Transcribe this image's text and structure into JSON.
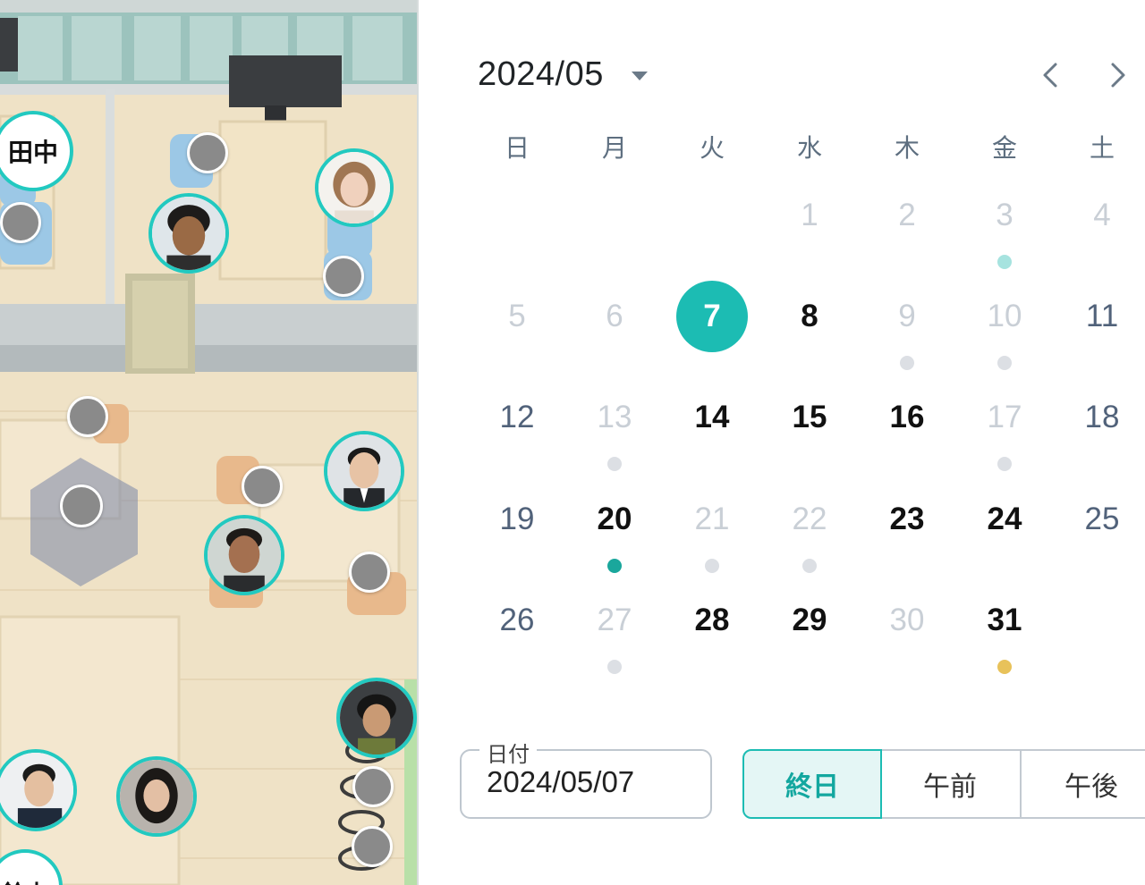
{
  "map": {
    "avatars": [
      {
        "name": "avatar-tanaka-label",
        "label": "田中"
      },
      {
        "name": "avatar-man-curly-hair",
        "label": ""
      },
      {
        "name": "avatar-woman-bob-hair",
        "label": ""
      },
      {
        "name": "avatar-man-suit-glasses",
        "label": ""
      },
      {
        "name": "avatar-man-dark-shirt",
        "label": ""
      },
      {
        "name": "avatar-man-headphones",
        "label": ""
      },
      {
        "name": "avatar-man-suit-smiling",
        "label": ""
      },
      {
        "name": "avatar-woman-long-hair",
        "label": ""
      }
    ],
    "bottom_badge_label": "鈴木"
  },
  "calendar": {
    "month_label": "2024/05",
    "weekdays": [
      "日",
      "月",
      "火",
      "水",
      "木",
      "金",
      "土"
    ],
    "days": [
      {
        "d": "1",
        "s": "disabled",
        "dot": ""
      },
      {
        "d": "2",
        "s": "disabled",
        "dot": ""
      },
      {
        "d": "3",
        "s": "disabled",
        "dot": "teal-light"
      },
      {
        "d": "4",
        "s": "disabled",
        "dot": ""
      },
      {
        "d": "5",
        "s": "disabled",
        "dot": ""
      },
      {
        "d": "6",
        "s": "disabled",
        "dot": ""
      },
      {
        "d": "7",
        "s": "selected",
        "dot": ""
      },
      {
        "d": "8",
        "s": "available",
        "dot": ""
      },
      {
        "d": "9",
        "s": "disabled",
        "dot": "gray"
      },
      {
        "d": "10",
        "s": "disabled",
        "dot": "gray"
      },
      {
        "d": "11",
        "s": "weekend",
        "dot": ""
      },
      {
        "d": "12",
        "s": "weekend",
        "dot": ""
      },
      {
        "d": "13",
        "s": "disabled",
        "dot": "gray"
      },
      {
        "d": "14",
        "s": "available",
        "dot": ""
      },
      {
        "d": "15",
        "s": "available",
        "dot": ""
      },
      {
        "d": "16",
        "s": "available",
        "dot": ""
      },
      {
        "d": "17",
        "s": "disabled",
        "dot": "gray"
      },
      {
        "d": "18",
        "s": "weekend",
        "dot": ""
      },
      {
        "d": "19",
        "s": "weekend",
        "dot": ""
      },
      {
        "d": "20",
        "s": "available",
        "dot": "teal"
      },
      {
        "d": "21",
        "s": "disabled",
        "dot": "gray"
      },
      {
        "d": "22",
        "s": "disabled",
        "dot": "gray"
      },
      {
        "d": "23",
        "s": "available",
        "dot": ""
      },
      {
        "d": "24",
        "s": "available",
        "dot": ""
      },
      {
        "d": "25",
        "s": "weekend",
        "dot": ""
      },
      {
        "d": "26",
        "s": "weekend",
        "dot": ""
      },
      {
        "d": "27",
        "s": "disabled",
        "dot": "gray"
      },
      {
        "d": "28",
        "s": "available",
        "dot": ""
      },
      {
        "d": "29",
        "s": "available",
        "dot": ""
      },
      {
        "d": "30",
        "s": "disabled",
        "dot": ""
      },
      {
        "d": "31",
        "s": "available",
        "dot": "yellow"
      }
    ],
    "first_weekday_index": 3,
    "dot_colors": {
      "teal": "#1aa79c",
      "teal-light": "#a6e3df",
      "gray": "#dcdfe4",
      "yellow": "#e8c25a"
    },
    "nav": {
      "prev_icon": "chevron-left-icon",
      "next_icon": "chevron-right-icon",
      "dropdown_icon": "caret-down-icon"
    }
  },
  "date_field": {
    "label": "日付",
    "value": "2024/05/07"
  },
  "time_segments": [
    {
      "label": "終日",
      "active": true
    },
    {
      "label": "午前",
      "active": false
    },
    {
      "label": "午後",
      "active": false
    }
  ],
  "colors": {
    "accent": "#1cbcb3",
    "avatar_ring": "#22c9c0"
  }
}
